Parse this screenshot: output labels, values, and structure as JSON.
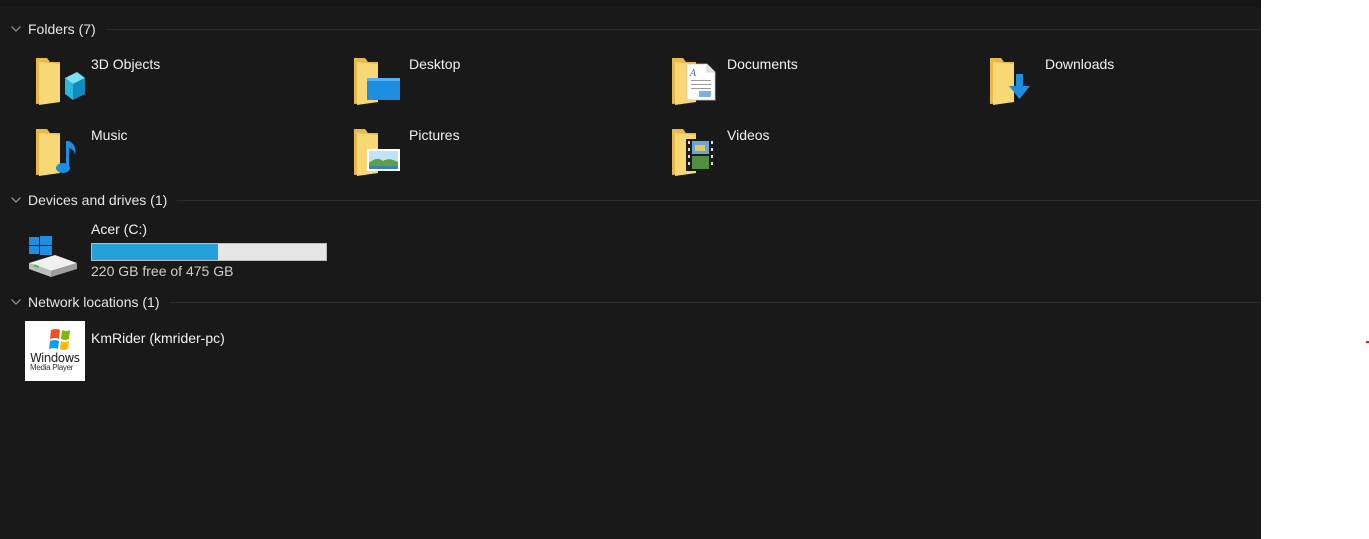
{
  "groups": {
    "folders": {
      "title": "Folders (7)",
      "items": [
        {
          "label": "3D Objects",
          "icon": "3d-objects-folder-icon"
        },
        {
          "label": "Desktop",
          "icon": "desktop-folder-icon"
        },
        {
          "label": "Documents",
          "icon": "documents-folder-icon"
        },
        {
          "label": "Downloads",
          "icon": "downloads-folder-icon"
        },
        {
          "label": "Music",
          "icon": "music-folder-icon"
        },
        {
          "label": "Pictures",
          "icon": "pictures-folder-icon"
        },
        {
          "label": "Videos",
          "icon": "videos-folder-icon"
        }
      ]
    },
    "devices": {
      "title": "Devices and drives (1)",
      "drives": [
        {
          "label": "Acer (C:)",
          "free_text": "220 GB free of 475 GB",
          "used_fraction": 0.537,
          "icon": "windows-drive-icon"
        }
      ]
    },
    "network": {
      "title": "Network locations (1)",
      "items": [
        {
          "label": "KmRider (kmrider-pc)",
          "icon": "windows-media-player-icon",
          "logo_text_1": "Windows",
          "logo_text_2": "Media Player"
        }
      ]
    }
  },
  "colors": {
    "background": "#191919",
    "drive_bar_fill": "#26a0da",
    "drive_bar_track": "#e6e6e6",
    "folder_yellow": "#f8d775"
  }
}
